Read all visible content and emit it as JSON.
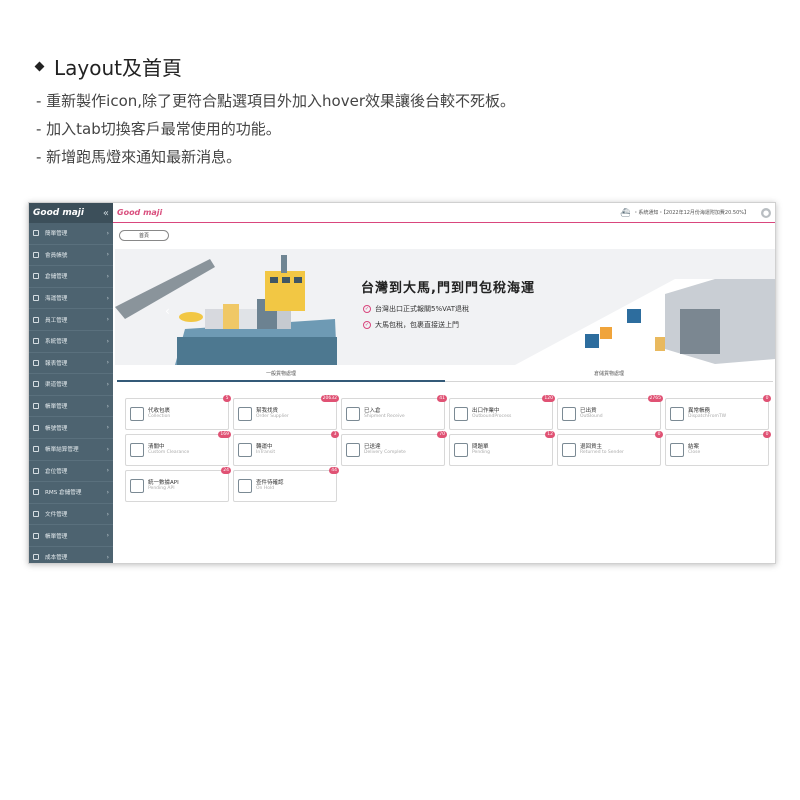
{
  "notes": {
    "title": "Layout及首頁",
    "lines": [
      "- 重新製作icon,除了更符合點選項目外加入hover效果讓後台較不死板。",
      "- 加入tab切換客戶最常使用的功能。",
      "- 新增跑馬燈來通知最新消息。"
    ]
  },
  "app": {
    "logo": "Good maji",
    "collapse_icon": "«",
    "sidebar": {
      "items": [
        {
          "label": "簡單管理"
        },
        {
          "label": "會員帳號"
        },
        {
          "label": "倉儲管理"
        },
        {
          "label": "海運管理"
        },
        {
          "label": "員工管理"
        },
        {
          "label": "系統管理"
        },
        {
          "label": "報表管理"
        },
        {
          "label": "渠道管理"
        },
        {
          "label": "帳單管理"
        },
        {
          "label": "帳號管理"
        },
        {
          "label": "帳單結算管理"
        },
        {
          "label": "倉位管理"
        },
        {
          "label": "RMS 倉儲管理"
        },
        {
          "label": "文件管理"
        },
        {
          "label": "帳單管理"
        },
        {
          "label": "成本管理"
        }
      ]
    },
    "topbar": {
      "logo": "Good maji",
      "marquee": "・系統通知・【2022年12月份海運附加費20.50%】"
    },
    "breadcrumb": "首頁",
    "banner": {
      "title": "台灣到大馬,門到門包稅海運",
      "line1": "台灣出口正式報關5%VAT退稅",
      "line2": "大馬包稅，包裹直接送上門",
      "check": "✓",
      "prev": "‹"
    },
    "tabs": [
      "一般貨物處理",
      "倉儲貨物處理"
    ],
    "cards": [
      {
        "title": "代收包裹",
        "sub": "Collection",
        "badge": "5"
      },
      {
        "title": "幫我找貨",
        "sub": "Order Supplier",
        "badge": "20632"
      },
      {
        "title": "已入倉",
        "sub": "Shipment Receive",
        "badge": "41"
      },
      {
        "title": "出口作業中",
        "sub": "OutboundProcess",
        "badge": "120"
      },
      {
        "title": "已出貨",
        "sub": "OutBound",
        "badge": "2765"
      },
      {
        "title": "異常帳務",
        "sub": "DispatchFromTW",
        "badge": "0"
      },
      {
        "title": "清關中",
        "sub": "Custom Clearance",
        "badge": "169"
      },
      {
        "title": "轉運中",
        "sub": "InTransit",
        "badge": "3"
      },
      {
        "title": "已送達",
        "sub": "Delivery Complete",
        "badge": "70"
      },
      {
        "title": "問題單",
        "sub": "Pending",
        "badge": "12"
      },
      {
        "title": "退回貨主",
        "sub": "Returned to Sender",
        "badge": "0"
      },
      {
        "title": "結案",
        "sub": "Close",
        "badge": "0"
      },
      {
        "title": "統一數據API",
        "sub": "Pending API",
        "badge": "24"
      },
      {
        "title": "查件待確認",
        "sub": "On Hold",
        "badge": "44"
      }
    ],
    "user_icon": "●"
  }
}
